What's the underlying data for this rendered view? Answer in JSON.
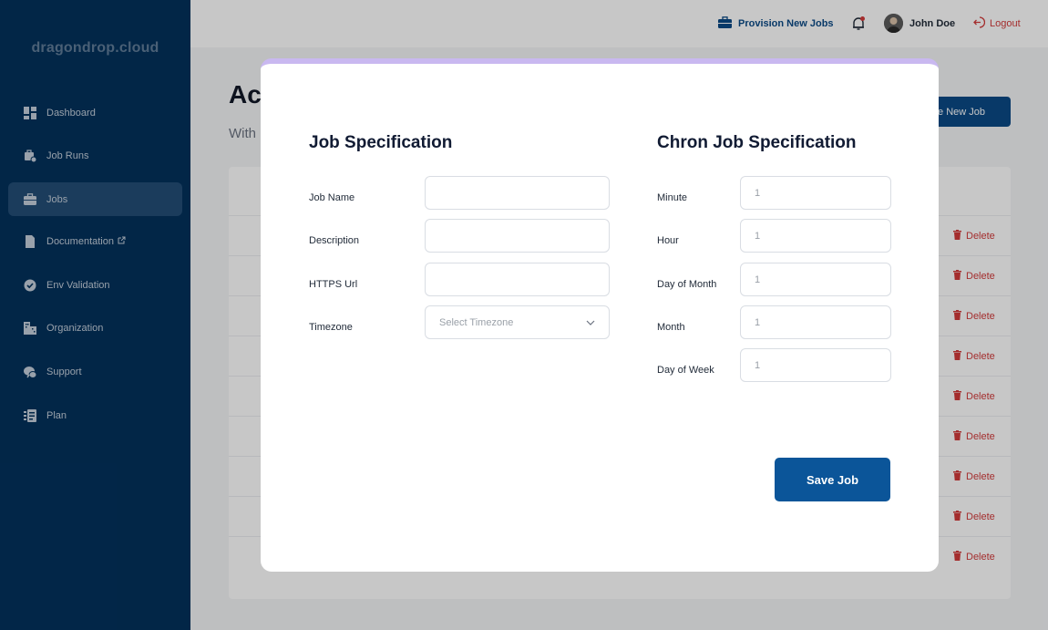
{
  "sidebar": {
    "brand": "dragondrop.cloud",
    "items": [
      {
        "label": "Dashboard",
        "icon": "dashboard-icon"
      },
      {
        "label": "Job Runs",
        "icon": "job-runs-icon"
      },
      {
        "label": "Jobs",
        "icon": "briefcase-icon"
      },
      {
        "label": "Documentation",
        "icon": "document-icon"
      },
      {
        "label": "Env Validation",
        "icon": "check-circle-icon"
      },
      {
        "label": "Organization",
        "icon": "building-icon"
      },
      {
        "label": "Support",
        "icon": "support-icon"
      },
      {
        "label": "Plan",
        "icon": "plan-icon"
      }
    ],
    "active_item": "Jobs"
  },
  "topbar": {
    "provision_label": "Provision New Jobs",
    "user_name": "John Doe",
    "logout_label": "Logout"
  },
  "background_page": {
    "title": "Ac",
    "subtitle": "With",
    "create_button_label": "e New Job",
    "delete_label": "Delete",
    "row_count": 9
  },
  "modal": {
    "job_spec": {
      "title": "Job Specification",
      "fields": [
        {
          "label": "Job Name",
          "value": "",
          "placeholder": ""
        },
        {
          "label": "Description",
          "value": "",
          "placeholder": ""
        },
        {
          "label": "HTTPS Url",
          "value": "",
          "placeholder": ""
        }
      ],
      "timezone": {
        "label": "Timezone",
        "placeholder": "Select Timezone"
      }
    },
    "chron_spec": {
      "title": "Chron Job Specification",
      "fields": [
        {
          "label": "Minute",
          "placeholder": "1"
        },
        {
          "label": "Hour",
          "placeholder": "1"
        },
        {
          "label": "Day of Month",
          "placeholder": "1"
        },
        {
          "label": "Month",
          "placeholder": "1"
        },
        {
          "label": "Day of Week",
          "placeholder": "1"
        }
      ]
    },
    "save_label": "Save Job"
  },
  "colors": {
    "sidebar_bg": "#03315c",
    "primary": "#0b5599",
    "danger": "#d23a3a",
    "modal_accent": "#c9b8f0"
  }
}
